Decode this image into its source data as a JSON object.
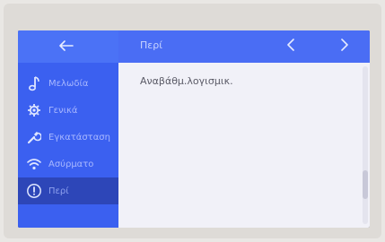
{
  "header": {
    "back_icon": "arrow-left-icon",
    "title": "Περί",
    "prev_icon": "chevron-left-icon",
    "next_icon": "chevron-right-icon"
  },
  "sidebar": {
    "items": [
      {
        "label": "Μελωδία",
        "icon": "music-note-icon",
        "active": false
      },
      {
        "label": "Γενικά",
        "icon": "gear-icon",
        "active": false
      },
      {
        "label": "Εγκατάσταση",
        "icon": "wrench-icon",
        "active": false
      },
      {
        "label": "Ασύρματο",
        "icon": "wifi-icon",
        "active": false
      },
      {
        "label": "Περί",
        "icon": "info-icon",
        "active": true
      }
    ]
  },
  "content": {
    "items": [
      {
        "label": "Αναβάθμ.λογισμικ."
      }
    ]
  },
  "colors": {
    "accent": "#4a6df4",
    "sidebar": "#3b60f0",
    "active_item": "#2d46b8",
    "content_bg": "#f1f1f8"
  }
}
